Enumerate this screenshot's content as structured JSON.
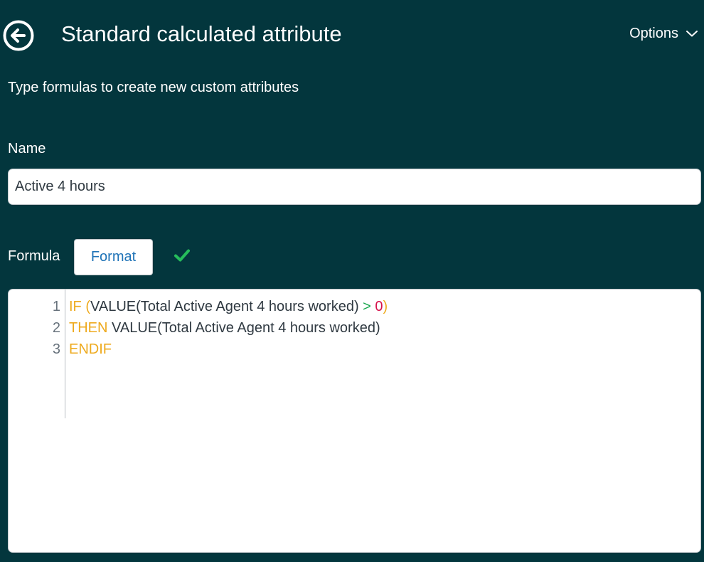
{
  "header": {
    "title": "Standard calculated attribute",
    "options_label": "Options"
  },
  "subtitle": "Type formulas to create new custom attributes",
  "name_field": {
    "label": "Name",
    "value": "Active 4 hours"
  },
  "formula": {
    "label": "Formula",
    "format_button": "Format",
    "valid": true,
    "lines": [
      {
        "number": "1",
        "tokens": [
          {
            "text": "IF",
            "kind": "keyword"
          },
          {
            "text": " ",
            "kind": "plain"
          },
          {
            "text": "(",
            "kind": "keyword"
          },
          {
            "text": "VALUE(Total Active Agent 4 hours worked) ",
            "kind": "plain"
          },
          {
            "text": ">",
            "kind": "operator"
          },
          {
            "text": " ",
            "kind": "plain"
          },
          {
            "text": "0",
            "kind": "number"
          },
          {
            "text": ")",
            "kind": "keyword"
          }
        ]
      },
      {
        "number": "2",
        "tokens": [
          {
            "text": "THEN",
            "kind": "keyword"
          },
          {
            "text": " VALUE(Total Active Agent 4 hours worked)",
            "kind": "plain"
          }
        ]
      },
      {
        "number": "3",
        "tokens": [
          {
            "text": "ENDIF",
            "kind": "keyword"
          }
        ]
      }
    ]
  },
  "colors": {
    "background": "#03363d",
    "keyword": "#eeaa1e",
    "operator": "#17a74d",
    "number": "#d6114b",
    "check": "#26bd5b",
    "button_text": "#1f73b7"
  },
  "icons": {
    "back": "arrow-left-circle-icon",
    "options": "chevron-down-icon",
    "validation": "checkmark-icon"
  }
}
